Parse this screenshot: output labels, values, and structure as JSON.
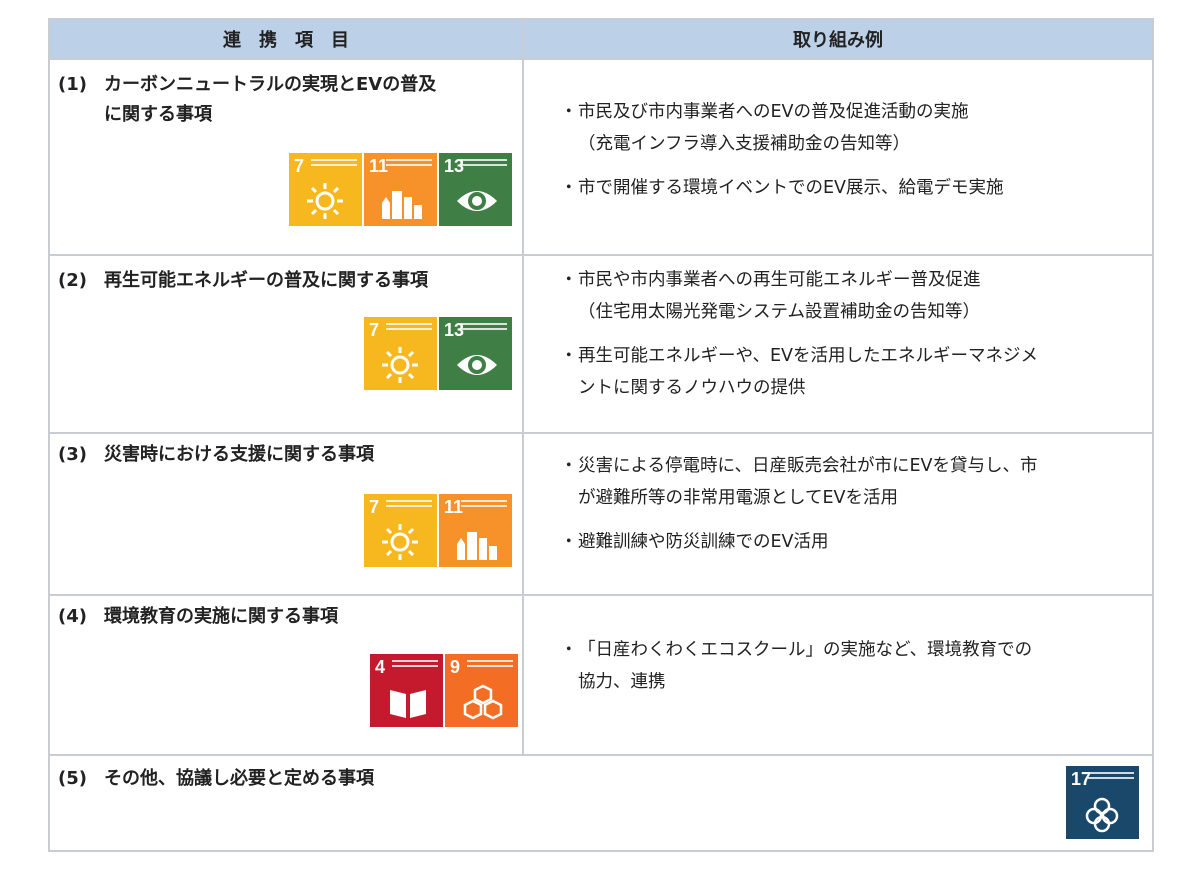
{
  "header": {
    "col1": "連　携　項　目",
    "col2": "取り組み例"
  },
  "rows": [
    {
      "num": "(1)",
      "title_line1": "カーボンニュートラルの実現とEVの普及",
      "title_line2": "に関する事項",
      "sdgs": [
        "7",
        "11",
        "13"
      ],
      "bullets": [
        {
          "l1": "市民及び市内事業者へのEVの普及促進活動の実施",
          "l2": "（充電インフラ導入支援補助金の告知等）"
        },
        {
          "l1": "市で開催する環境イベントでのEV展示、給電デモ実施",
          "l2": ""
        }
      ]
    },
    {
      "num": "(2)",
      "title_line1": "再生可能エネルギーの普及に関する事項",
      "sdgs": [
        "7",
        "13"
      ],
      "bullets": [
        {
          "l1": "市民や市内事業者への再生可能エネルギー普及促進",
          "l2": "（住宅用太陽光発電システム設置補助金の告知等）"
        },
        {
          "l1": "再生可能エネルギーや、EVを活用したエネルギーマネジメ",
          "l2": "ントに関するノウハウの提供"
        }
      ]
    },
    {
      "num": "(3)",
      "title_line1": "災害時における支援に関する事項",
      "sdgs": [
        "7",
        "11"
      ],
      "bullets": [
        {
          "l1": "災害による停電時に、日産販売会社が市にEVを貸与し、市",
          "l2": "が避難所等の非常用電源としてEVを活用"
        },
        {
          "l1": "避難訓練や防災訓練でのEV活用",
          "l2": ""
        }
      ]
    },
    {
      "num": "(4)",
      "title_line1": "環境教育の実施に関する事項",
      "sdgs": [
        "4",
        "9"
      ],
      "bullets": [
        {
          "l1": "「日産わくわくエコスクール」の実施など、環境教育での",
          "l2": "協力、連携"
        }
      ]
    },
    {
      "num": "(5)",
      "title_line1": "その他、協議し必要と定める事項",
      "sdgs": [
        "17"
      ]
    }
  ],
  "bullet_mark": "・",
  "colors": {
    "header_bg": "#bcd0e8",
    "border": "#c9ccd1",
    "sdg7": "#f6b81e",
    "sdg11": "#f7922a",
    "sdg13": "#3f7e44",
    "sdg4": "#c5192d",
    "sdg9": "#f36d25",
    "sdg17": "#19486a"
  },
  "icons": {
    "sdg7": "sun-icon",
    "sdg11": "city-buildings-icon",
    "sdg13": "eye-earth-icon",
    "sdg4": "open-book-icon",
    "sdg9": "cubes-icon",
    "sdg17": "rings-icon"
  }
}
